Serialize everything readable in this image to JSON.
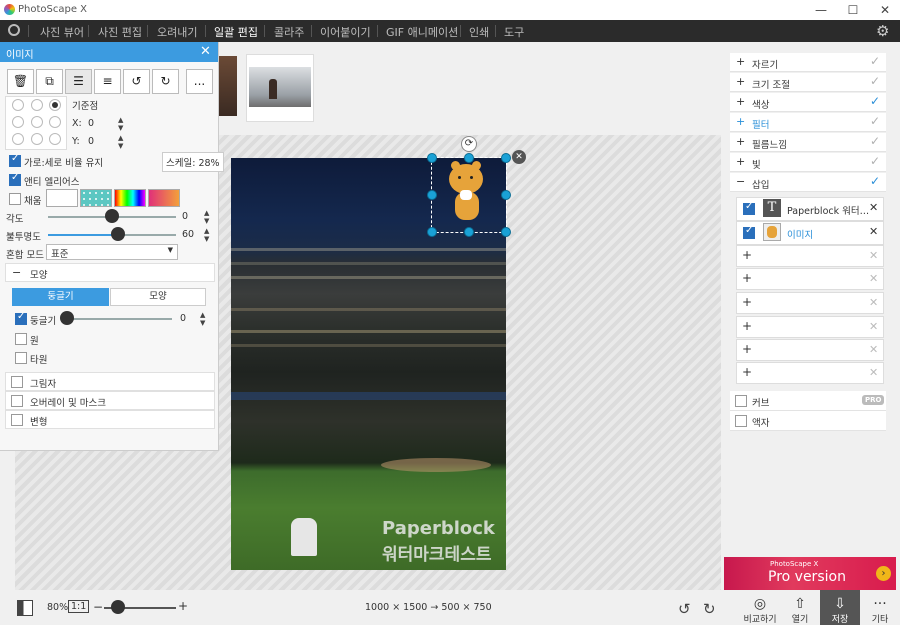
{
  "app": {
    "title": "PhotoScape X"
  },
  "window_controls": {
    "minimize": "—",
    "maximize": "☐",
    "close": "✕"
  },
  "menu": [
    "사진 뷰어",
    "사진 편집",
    "오려내기",
    "일괄 편집",
    "콜라주",
    "이어붙이기",
    "GIF 애니메이션",
    "인쇄",
    "도구"
  ],
  "menu_active": "일괄 편집",
  "left_panel": {
    "title": "이미지",
    "tool_more": "...",
    "anchor_label": "기준점",
    "x_label": "X:",
    "x_value": "0",
    "y_label": "Y:",
    "y_value": "0",
    "keep_ratio": "가로:세로 비율 유지",
    "scale": "스케일: 28%",
    "antialias": "앤티 엘리어스",
    "fill": "채움",
    "angle_label": "각도",
    "angle_value": "0",
    "opacity_label": "불투명도",
    "opacity_value": "60",
    "blend_label": "혼합 모드",
    "blend_value": "표준",
    "shape_section": "모양",
    "tab_round": "둥글기",
    "tab_shape": "모양",
    "round_label": "둥글기",
    "round_value": "0",
    "circle": "원",
    "ellipse": "타원",
    "shadow": "그림자",
    "overlay": "오버레이 및 마스크",
    "transform": "변형"
  },
  "right_panel": {
    "items": [
      {
        "sign": "+",
        "label": "자르기"
      },
      {
        "sign": "+",
        "label": "크기 조절"
      },
      {
        "sign": "+",
        "label": "색상"
      },
      {
        "sign": "+",
        "label": "필터"
      },
      {
        "sign": "+",
        "label": "필름느낌"
      },
      {
        "sign": "+",
        "label": "빛"
      },
      {
        "sign": "−",
        "label": "삽입"
      }
    ],
    "layers": [
      {
        "label": "Paperblock 워터…"
      },
      {
        "label": "이미지"
      }
    ],
    "curve": "커브",
    "pro_badge": "PRO",
    "frame": "액자"
  },
  "photo": {
    "watermark_line1": "Paperblock",
    "watermark_line2": "워터마크테스트"
  },
  "bottom": {
    "zoom": "80%",
    "ratio": "1:1",
    "size_info": "1000 × 1500 → 500 × 750",
    "compare": "비교하기",
    "open": "열기",
    "save": "저장",
    "more": "기타"
  },
  "promo": {
    "small": "PhotoScape X",
    "big": "Pro version"
  }
}
